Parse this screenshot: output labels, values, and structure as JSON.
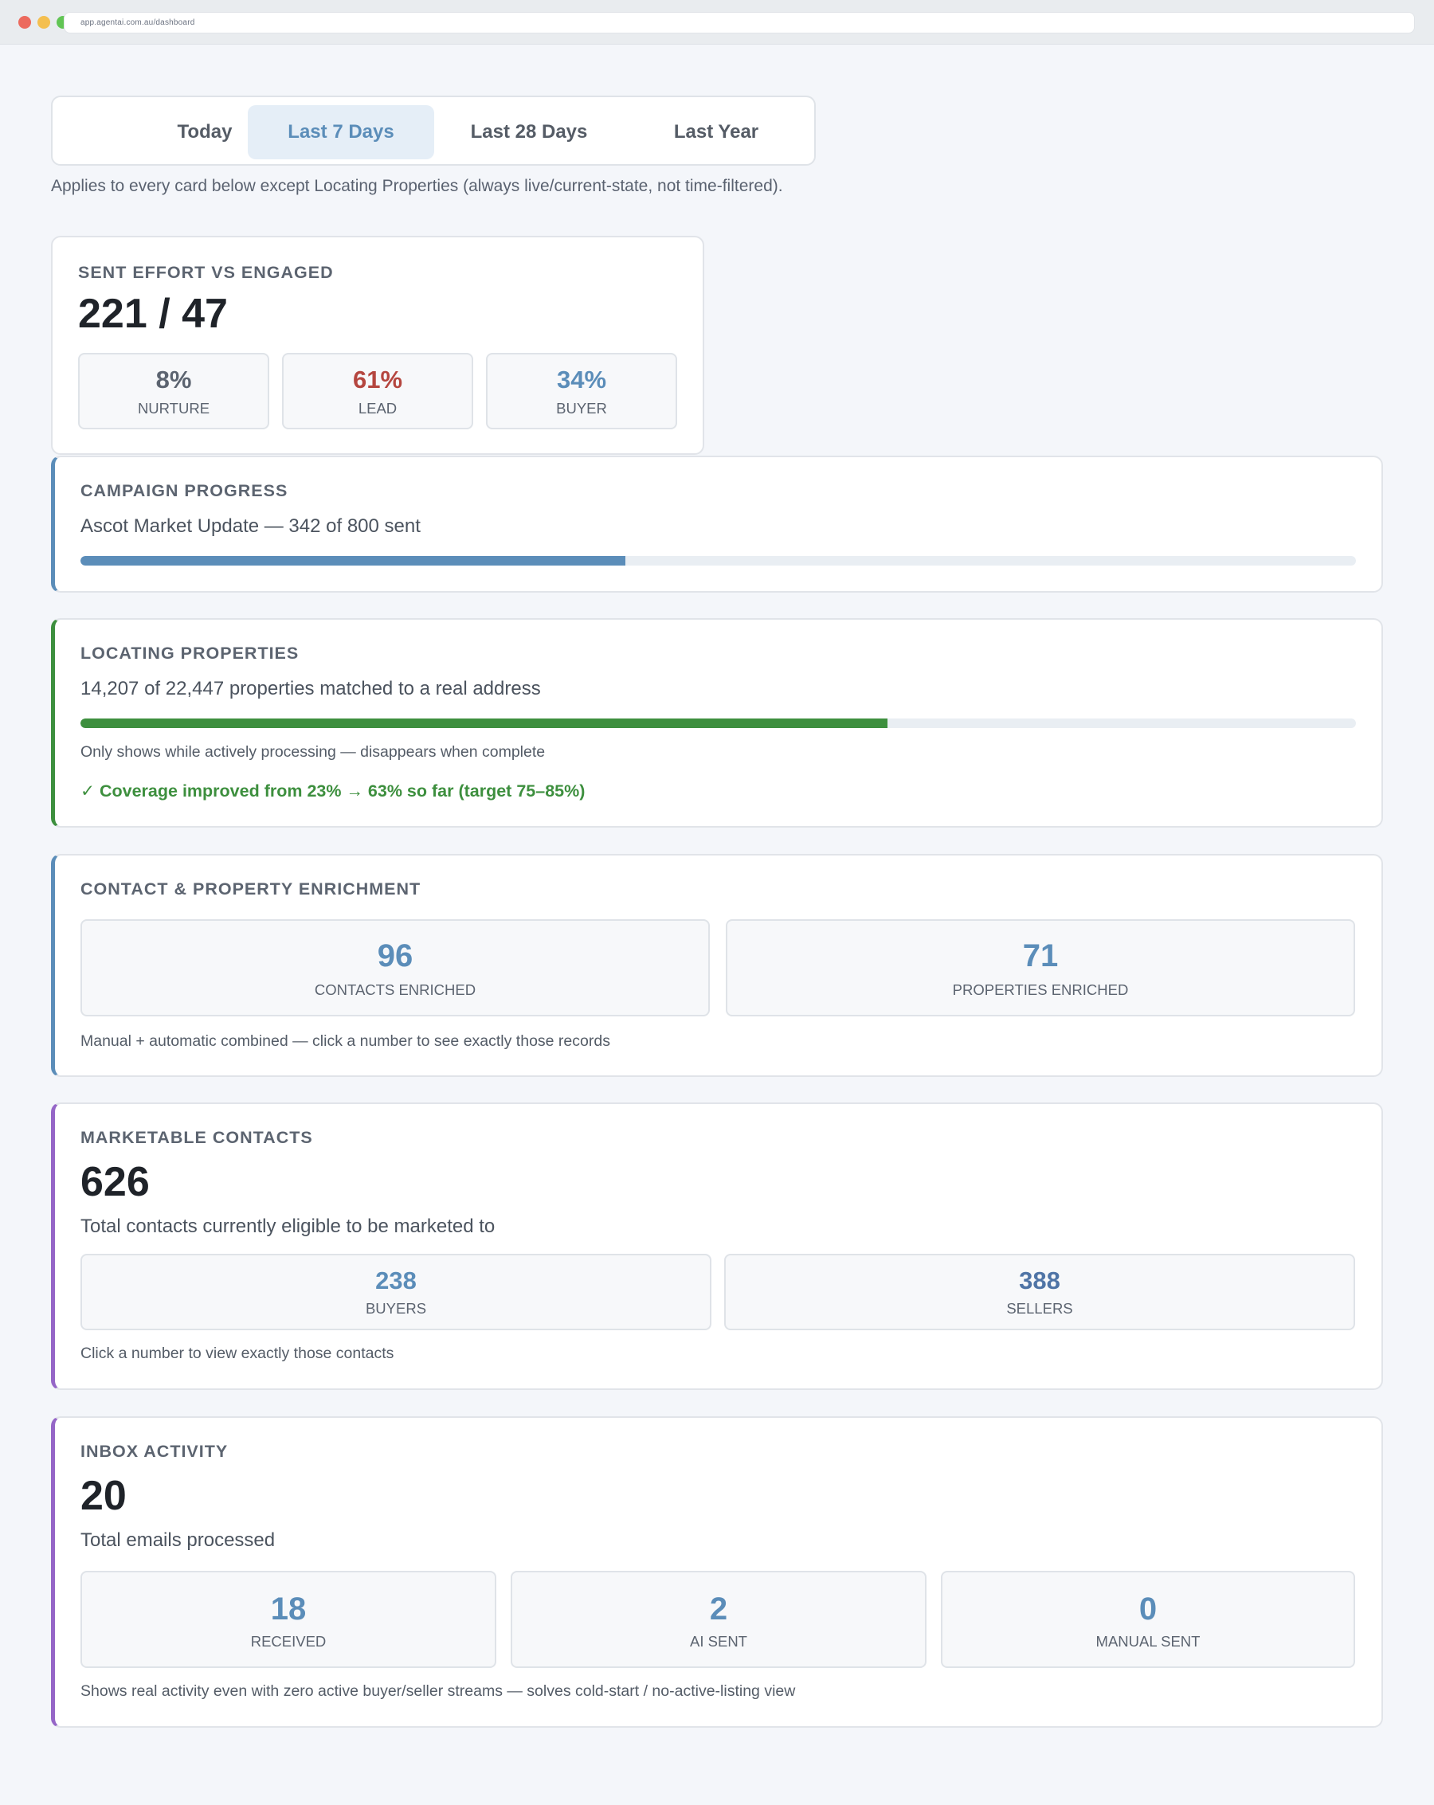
{
  "browser": {
    "url": "app.agentai.com.au/dashboard"
  },
  "colors": {
    "blue": "#5b8db9",
    "red": "#b5463f",
    "green": "#3d8f3e",
    "purple": "#9566c7",
    "gray": "#5c6470"
  },
  "range_tabs": {
    "items": [
      {
        "label": "Today",
        "active": false
      },
      {
        "label": "Last 7 Days",
        "active": true
      },
      {
        "label": "Last 28 Days",
        "active": false
      },
      {
        "label": "Last Year",
        "active": false
      }
    ],
    "note": "Applies to every card below except Locating Properties (always live/current-state, not time-filtered)."
  },
  "sent_effort": {
    "title": "SENT EFFORT VS ENGAGED",
    "value": "221 / 47",
    "stats": [
      {
        "value": "8%",
        "label": "NURTURE"
      },
      {
        "value": "61%",
        "label": "LEAD"
      },
      {
        "value": "34%",
        "label": "BUYER"
      }
    ]
  },
  "campaign_progress": {
    "title": "CAMPAIGN PROGRESS",
    "subtitle": "Ascot Market Update — 342 of 800 sent",
    "sent": 342,
    "total": 800
  },
  "locating_properties": {
    "title": "LOCATING PROPERTIES",
    "subtitle": "14,207 of 22,447 properties matched to a real address",
    "matched": 14207,
    "total": 22447,
    "note": "Only shows while actively processing — disappears when complete",
    "coverage": "✓ Coverage improved from 23% → 63% so far (target 75–85%)"
  },
  "enrichment": {
    "title": "CONTACT & PROPERTY ENRICHMENT",
    "stats": [
      {
        "value": "96",
        "label": "CONTACTS ENRICHED"
      },
      {
        "value": "71",
        "label": "PROPERTIES ENRICHED"
      }
    ],
    "note": "Manual + automatic combined — click a number to see exactly those records"
  },
  "marketable": {
    "title": "MARKETABLE CONTACTS",
    "value": "626",
    "subtitle": "Total contacts currently eligible to be marketed to",
    "stats": [
      {
        "value": "238",
        "label": "BUYERS"
      },
      {
        "value": "388",
        "label": "SELLERS"
      }
    ],
    "note": "Click a number to view exactly those contacts"
  },
  "inbox": {
    "title": "INBOX ACTIVITY",
    "value": "20",
    "subtitle": "Total emails processed",
    "stats": [
      {
        "value": "18",
        "label": "RECEIVED"
      },
      {
        "value": "2",
        "label": "AI SENT"
      },
      {
        "value": "0",
        "label": "MANUAL SENT"
      }
    ],
    "note": "Shows real activity even with zero active buyer/seller streams — solves cold-start / no-active-listing view"
  }
}
